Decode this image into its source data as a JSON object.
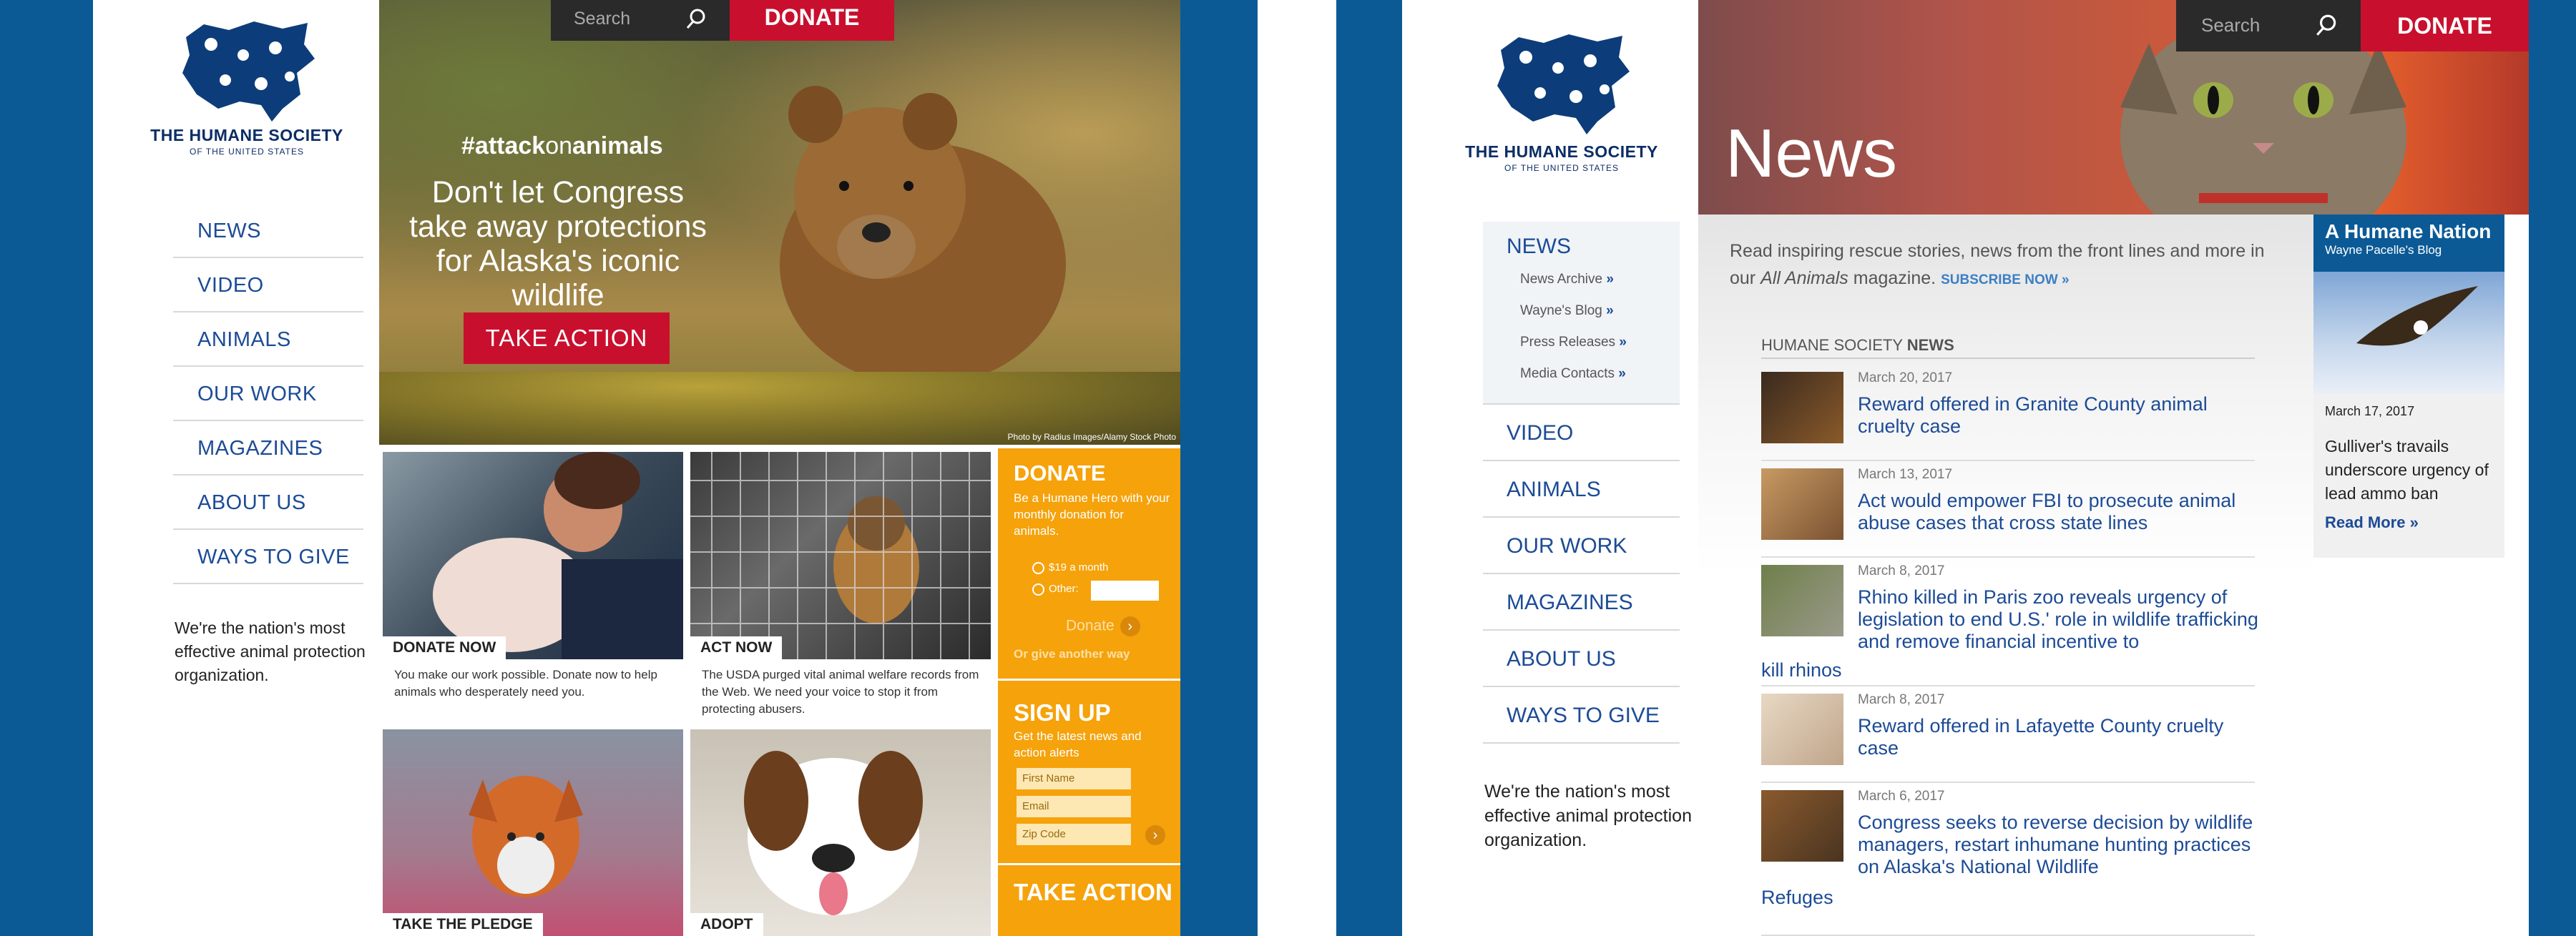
{
  "left": {
    "logo": {
      "name": "THE HUMANE SOCIETY",
      "sub": "OF THE UNITED STATES"
    },
    "nav": [
      "NEWS",
      "VIDEO",
      "ANIMALS",
      "OUR WORK",
      "MAGAZINES",
      "ABOUT US",
      "WAYS TO GIVE"
    ],
    "tagline": "We're the nation's most effective animal protection organization.",
    "search_placeholder": "Search",
    "donate_top": "DONATE",
    "hero": {
      "hashtag_a": "#attack",
      "hashtag_b": "on",
      "hashtag_c": "animals",
      "headline": "Don't let Congress take away protections for Alaska's iconic wildlife",
      "button": "TAKE ACTION",
      "credit": "Photo by Radius Images/Alamy Stock Photo"
    },
    "cards": [
      {
        "label": "DONATE NOW",
        "desc": "You make our work possible. Donate now to help animals who desperately need you."
      },
      {
        "label": "ACT NOW",
        "desc": "The USDA purged vital animal welfare records from the Web. We need your voice to stop it from protecting abusers."
      },
      {
        "label": "TAKE THE PLEDGE",
        "desc": ""
      },
      {
        "label": "ADOPT",
        "desc": ""
      }
    ],
    "side": {
      "donate_title": "DONATE",
      "donate_text": "Be a Humane Hero with your monthly donation for animals.",
      "opt1": "$19 a month",
      "opt2": "Other:",
      "donate_button": "Donate",
      "other_way": "Or give another way",
      "signup_title": "SIGN UP",
      "signup_text": "Get the latest news and action alerts",
      "first_name": "First Name",
      "email": "Email",
      "zip": "Zip Code",
      "take_action": "TAKE ACTION"
    }
  },
  "right": {
    "logo": {
      "name": "THE HUMANE SOCIETY",
      "sub": "OF THE UNITED STATES"
    },
    "nav_active": "NEWS",
    "subnav": [
      "News Archive",
      "Wayne's Blog",
      "Press Releases",
      "Media Contacts"
    ],
    "nav": [
      "VIDEO",
      "ANIMALS",
      "OUR WORK",
      "MAGAZINES",
      "ABOUT US",
      "WAYS TO GIVE"
    ],
    "tagline": "We're the nation's most effective animal protection organization.",
    "search_placeholder": "Search",
    "donate_top": "DONATE",
    "hero_title": "News",
    "intro_a": "Read inspiring rescue stories, news from the front lines and more in our",
    "intro_mag": "All Animals",
    "intro_b": "magazine.",
    "subscribe": "SUBSCRIBE NOW »",
    "section_a": "HUMANE SOCIETY",
    "section_b": "NEWS",
    "news": [
      {
        "date": "March 20, 2017",
        "title": "Reward offered in Granite County animal cruelty case"
      },
      {
        "date": "March 13, 2017",
        "title": "Act would empower FBI to prosecute animal abuse cases that cross state lines"
      },
      {
        "date": "March 8, 2017",
        "title": "Rhino killed in Paris zoo reveals urgency of legislation to end U.S.' role in wildlife trafficking and remove financial incentive to",
        "title_wrap": "kill rhinos"
      },
      {
        "date": "March 8, 2017",
        "title": "Reward offered in Lafayette County cruelty case"
      },
      {
        "date": "March 6, 2017",
        "title": "Congress seeks to reverse decision by wildlife managers, restart inhumane hunting practices on Alaska's National Wildlife",
        "title_wrap": "Refuges"
      }
    ],
    "blog": {
      "title": "A Humane Nation",
      "sub": "Wayne Pacelle's Blog",
      "date": "March 17, 2017",
      "text": "Gulliver's travails underscore urgency of lead ammo ban",
      "more": "Read More »"
    }
  }
}
